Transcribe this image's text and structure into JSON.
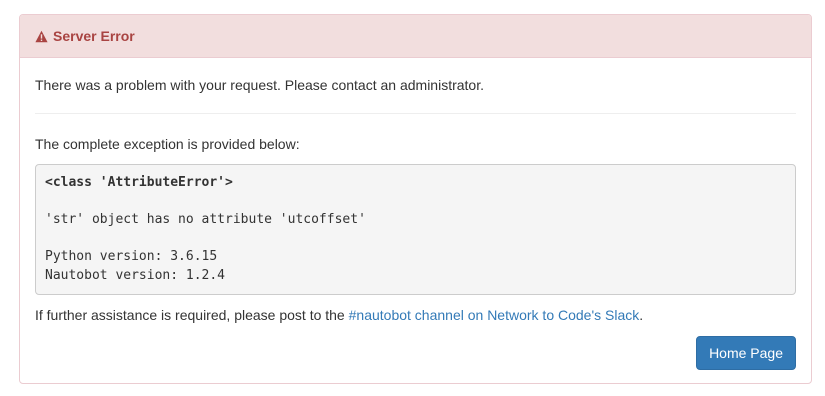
{
  "panel": {
    "heading": {
      "icon": "warning-triangle-icon",
      "title": "Server Error"
    },
    "intro_text": "There was a problem with your request. Please contact an administrator.",
    "exception_label": "The complete exception is provided below:",
    "exception": {
      "type_line": "<class 'AttributeError'>",
      "message": "'str' object has no attribute 'utcoffset'",
      "python_version": "Python version: 3.6.15",
      "nautobot_version": "Nautobot version: 1.2.4"
    },
    "help": {
      "prefix": "If further assistance is required, please post to the ",
      "link_text": "#nautobot channel on Network to Code's Slack",
      "suffix": "."
    },
    "home_button_label": "Home Page"
  },
  "colors": {
    "heading_bg": "#f2dede",
    "heading_text": "#a94442",
    "border": "#ebccd1",
    "link": "#337ab7",
    "button_bg": "#337ab7"
  }
}
